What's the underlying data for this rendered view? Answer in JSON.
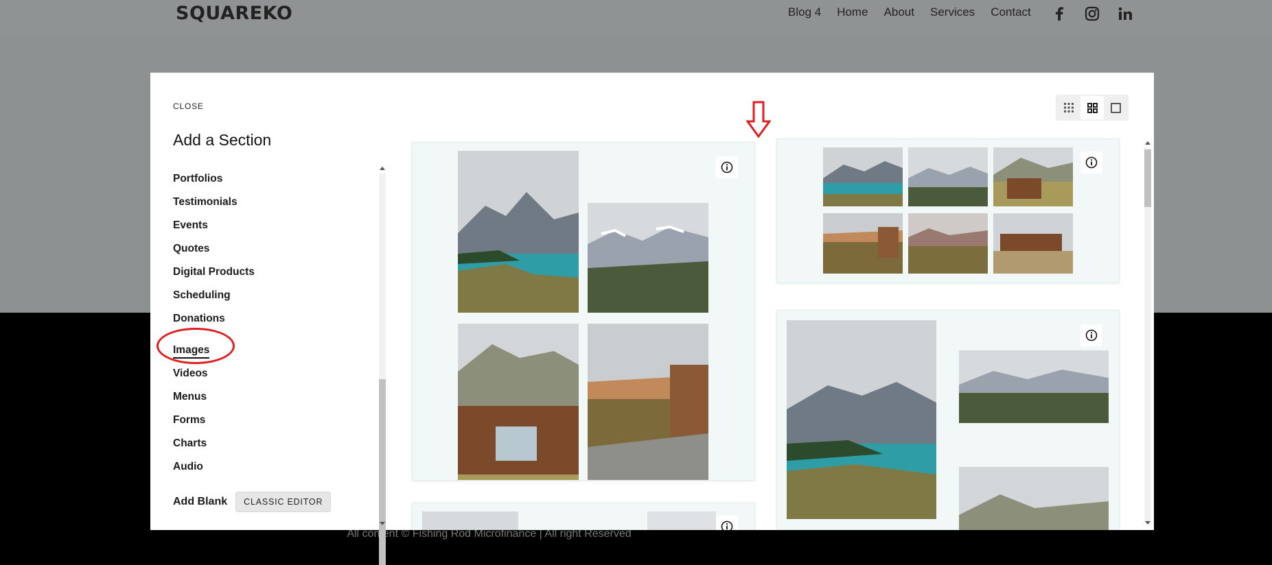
{
  "site": {
    "logo": "SQUAREKO",
    "nav": [
      "Blog 4",
      "Home",
      "About",
      "Services",
      "Contact"
    ],
    "social_icons": [
      "facebook-icon",
      "instagram-icon",
      "linkedin-icon"
    ],
    "footer_text": "All content © Fishing Rod Microfinance | All right Reserved"
  },
  "modal": {
    "close_label": "CLOSE",
    "title": "Add a Section",
    "categories": [
      "Portfolios",
      "Testimonials",
      "Events",
      "Quotes",
      "Digital Products",
      "Scheduling",
      "Donations",
      "Images",
      "Videos",
      "Menus",
      "Forms",
      "Charts",
      "Audio"
    ],
    "active_category": "Images",
    "add_blank_label": "Add Blank",
    "classic_editor_label": "CLASSIC EDITOR",
    "view_modes": [
      "small-grid-icon",
      "large-grid-icon",
      "single-view-icon"
    ],
    "active_view": "large-grid-icon"
  },
  "colors": {
    "annotation": "#e01e1e",
    "card_bg": "#f2f8f7"
  }
}
